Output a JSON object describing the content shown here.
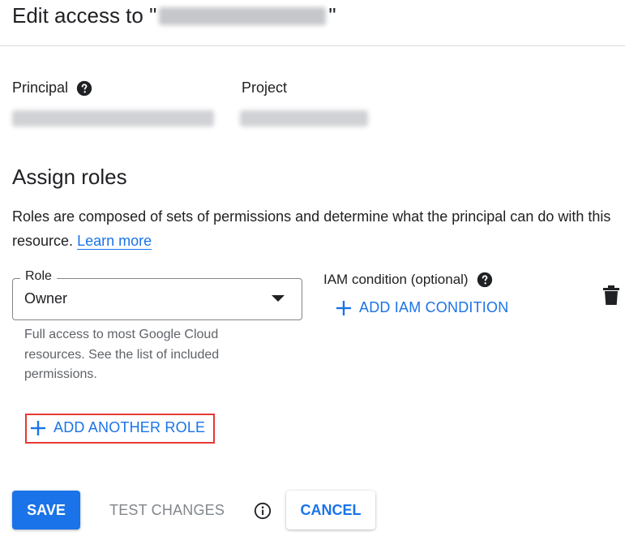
{
  "dialog": {
    "title_prefix": "Edit access to \"",
    "title_suffix": "\""
  },
  "principal": {
    "label": "Principal",
    "help_icon": "help-circle-icon"
  },
  "project": {
    "label": "Project"
  },
  "assign_roles": {
    "title": "Assign roles",
    "description": "Roles are composed of sets of permissions and determine what the principal can do with this resource.",
    "learn_more": "Learn more"
  },
  "role": {
    "label": "Role",
    "value": "Owner",
    "hint": "Full access to most Google Cloud resources. See the list of included permissions.",
    "dropdown_icon": "arrow-drop-down-icon"
  },
  "iam_condition": {
    "label": "IAM condition (optional)",
    "help_icon": "help-circle-icon",
    "add_button": "ADD IAM CONDITION",
    "add_icon": "plus-icon"
  },
  "delete_icon": "trash-icon",
  "add_another_role": {
    "label": "ADD ANOTHER ROLE",
    "icon": "plus-icon",
    "highlight_color": "#e53935"
  },
  "footer": {
    "save": "SAVE",
    "test_changes": "TEST CHANGES",
    "info_icon": "info-icon",
    "cancel": "CANCEL"
  },
  "colors": {
    "accent": "#1a73e8",
    "text": "#202124",
    "muted": "#5f6368",
    "disabled": "#80868b"
  }
}
